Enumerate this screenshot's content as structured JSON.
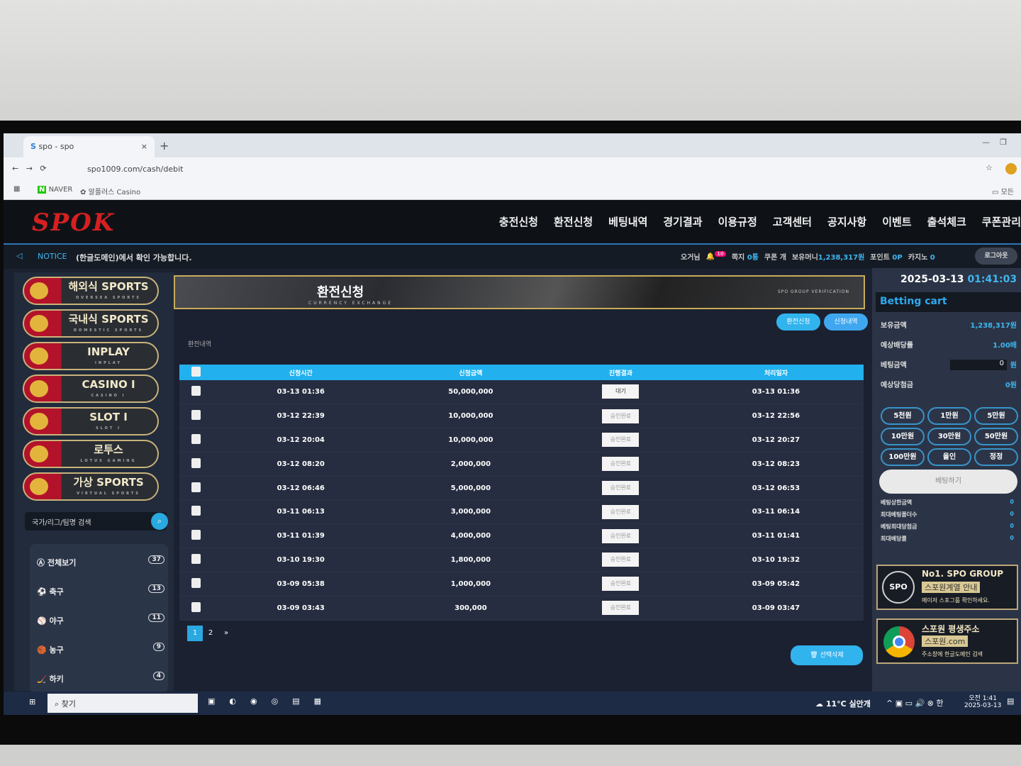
{
  "browser": {
    "tab_title": "spo - spo",
    "url": "spo1009.com/cash/debit",
    "bookmarks": [
      "NAVER",
      "알플러스 Casino"
    ],
    "right_label": "모든"
  },
  "header": {
    "logo": "SPOK",
    "nav": [
      "충전신청",
      "환전신청",
      "베팅내역",
      "경기결과",
      "이용규정",
      "고객센터",
      "공지사항",
      "이벤트",
      "출석체크",
      "쿠폰관리"
    ]
  },
  "notice": {
    "label": "NOTICE",
    "text": "(한글도메인)에서 확인 가능합니다.",
    "user": "오거님",
    "bell_count": "10",
    "memo_label": "쪽지",
    "memo": "0통",
    "coupon_label": "쿠폰",
    "coupon": "개",
    "money_label": "보유머니",
    "money": "1,238,317원",
    "point_label": "포인트",
    "point": "0P",
    "casino_label": "카지노",
    "casino": "0",
    "logout": "로그아웃"
  },
  "sidebar": {
    "games": [
      {
        "title": "해외식 SPORTS",
        "sub": "OVERSEA SPORTS"
      },
      {
        "title": "국내식 SPORTS",
        "sub": "DOMESTIC SPORTS"
      },
      {
        "title": "INPLAY",
        "sub": "INPLAY"
      },
      {
        "title": "CASINO Ⅰ",
        "sub": "CASINO I"
      },
      {
        "title": "SLOT Ⅰ",
        "sub": "SLOT I"
      },
      {
        "title": "로투스",
        "sub": "LOTUS GAMING"
      },
      {
        "title": "가상 SPORTS",
        "sub": "VIRTUAL SPORTS"
      }
    ],
    "search_placeholder": "국가/리그/팀명 검색",
    "categories": [
      {
        "label": "전체보기",
        "count": "37"
      },
      {
        "label": "축구",
        "count": "13"
      },
      {
        "label": "야구",
        "count": "11"
      },
      {
        "label": "농구",
        "count": "9"
      },
      {
        "label": "하키",
        "count": "4"
      }
    ]
  },
  "main": {
    "title": "환전신청",
    "subtitle": "CURRENCY EXCHANGE",
    "banner_right": "SPO GROUP VERIFICATION",
    "btn_apply": "환전신청",
    "btn_history": "신청내역",
    "section": "환전내역",
    "columns": [
      "신청시간",
      "신청금액",
      "진행결과",
      "처리일자"
    ],
    "rows": [
      [
        "03-13 01:36",
        "50,000,000",
        "대기",
        "03-13 01:36"
      ],
      [
        "03-12 22:39",
        "10,000,000",
        "승인완료",
        "03-12 22:56"
      ],
      [
        "03-12 20:04",
        "10,000,000",
        "승인완료",
        "03-12 20:27"
      ],
      [
        "03-12 08:20",
        "2,000,000",
        "승인완료",
        "03-12 08:23"
      ],
      [
        "03-12 06:46",
        "5,000,000",
        "승인완료",
        "03-12 06:53"
      ],
      [
        "03-11 06:13",
        "3,000,000",
        "승인완료",
        "03-11 06:14"
      ],
      [
        "03-11 01:39",
        "4,000,000",
        "승인완료",
        "03-11 01:41"
      ],
      [
        "03-10 19:30",
        "1,800,000",
        "승인완료",
        "03-10 19:32"
      ],
      [
        "03-09 05:38",
        "1,000,000",
        "승인완료",
        "03-09 05:42"
      ],
      [
        "03-09 03:43",
        "300,000",
        "승인완료",
        "03-09 03:47"
      ]
    ],
    "pages": [
      "1",
      "2",
      "»"
    ],
    "delete_btn": "선택삭제"
  },
  "right": {
    "date": "2025-03-13",
    "time": "01:41:03",
    "cart_title": "Betting cart",
    "rows": [
      {
        "label": "보유금액",
        "value": "1,238,317원"
      },
      {
        "label": "예상배당률",
        "value": "1.00배"
      },
      {
        "label": "베팅금액",
        "value": "0"
      },
      {
        "label": "예상당첨금",
        "value": "0원"
      }
    ],
    "bet_unit": "원",
    "chips": [
      "5천원",
      "1만원",
      "5만원",
      "10만원",
      "30만원",
      "50만원",
      "100만원",
      "올인",
      "정정"
    ],
    "bet_btn": "베팅하기",
    "limits": [
      {
        "label": "베팅상한금액",
        "value": "0"
      },
      {
        "label": "최대베팅폴더수",
        "value": "0"
      },
      {
        "label": "베팅최대당첨금",
        "value": "0"
      },
      {
        "label": "최대배당률",
        "value": "0"
      }
    ],
    "ad1": {
      "title": "No1. SPO GROUP",
      "sub": "스포원계열 안내",
      "note": "메이저 스포그룹 확인하세요."
    },
    "ad2": {
      "title": "스포원 평생주소",
      "sub": "스포원.com",
      "note": "주소창에 한글도메인 검색"
    }
  },
  "taskbar": {
    "search": "찾기",
    "weather": "11°C 실안개",
    "time": "오전 1:41",
    "date": "2025-03-13",
    "ime": "한"
  }
}
